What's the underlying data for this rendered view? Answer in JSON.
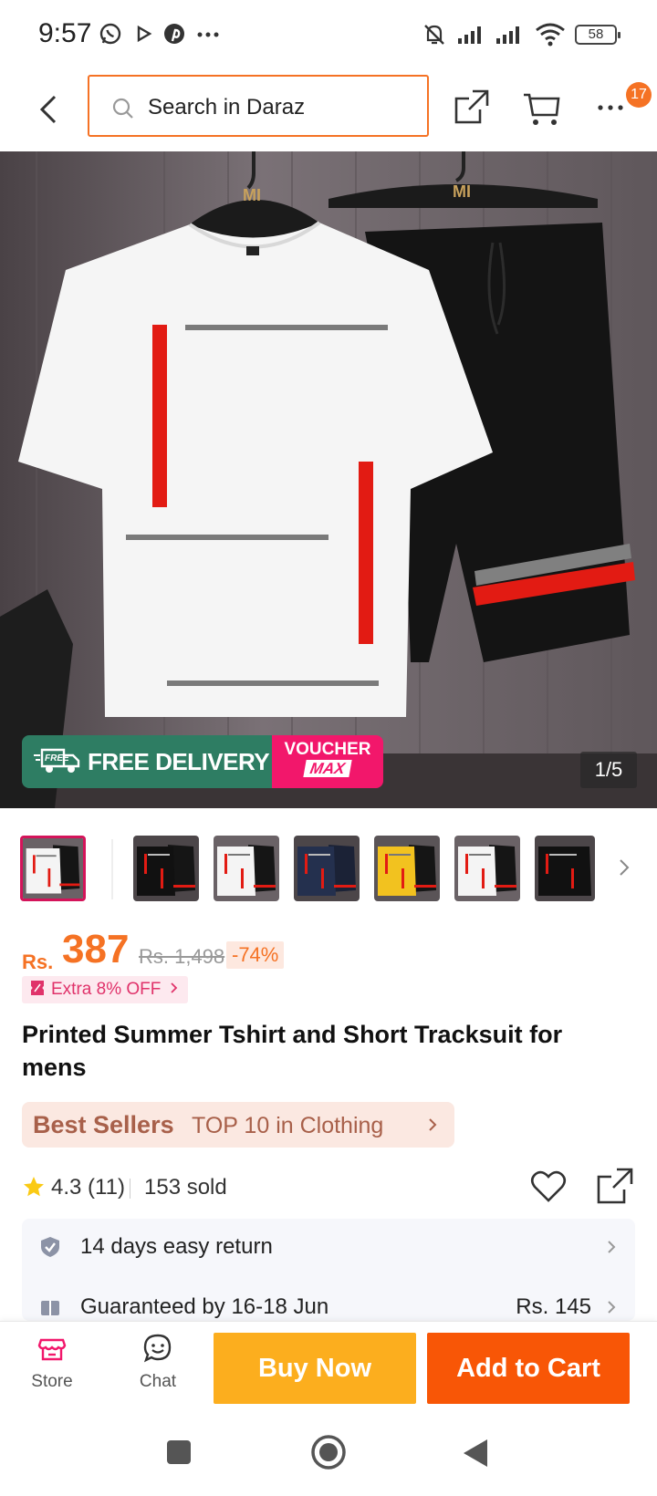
{
  "status_bar": {
    "time": "9:57",
    "battery": "58",
    "icons": [
      "whatsapp-icon",
      "play-icon",
      "pinterest-icon",
      "more-dots-icon",
      "mute-icon",
      "signal-icon",
      "signal-icon",
      "wifi-icon",
      "battery-icon"
    ]
  },
  "header": {
    "search_placeholder": "Search in Daraz",
    "cart_badge": "17",
    "icons": [
      "back-icon",
      "search-icon",
      "share-icon",
      "cart-icon",
      "more-icon"
    ]
  },
  "hero": {
    "counter": "1/5",
    "promo_free": "FREE",
    "promo_delivery": "FREE DELIVERY",
    "promo_voucher": "VOUCHER",
    "promo_max": "MAX"
  },
  "thumbnails": {
    "colors": [
      "white",
      "black",
      "white",
      "navy",
      "yellow",
      "white",
      "black"
    ],
    "selected_index": 0
  },
  "price": {
    "currency": "Rs.",
    "value": "387",
    "original": "Rs. 1,498",
    "discount": "-74%"
  },
  "extra_offer": {
    "label": "Extra 8% OFF"
  },
  "product": {
    "title": "Printed Summer Tshirt and Short Tracksuit for mens"
  },
  "best_sellers": {
    "label": "Best Sellers",
    "rank": "TOP 10 in Clothing"
  },
  "rating": {
    "score": "4.3",
    "count": "(11)",
    "sold": "153 sold"
  },
  "info_rows": [
    {
      "text": "14 days easy return",
      "value": ""
    },
    {
      "text": "Guaranteed by 16-18 Jun",
      "value": "Rs. 145"
    }
  ],
  "actions": {
    "store": "Store",
    "chat": "Chat",
    "buy_now": "Buy Now",
    "add_to_cart": "Add to Cart"
  },
  "colors": {
    "accent": "#f57224",
    "buy_now": "#fcae1e",
    "add_to_cart": "#f85606",
    "promo_green": "#2e7d63",
    "promo_pink": "#f2176b"
  }
}
